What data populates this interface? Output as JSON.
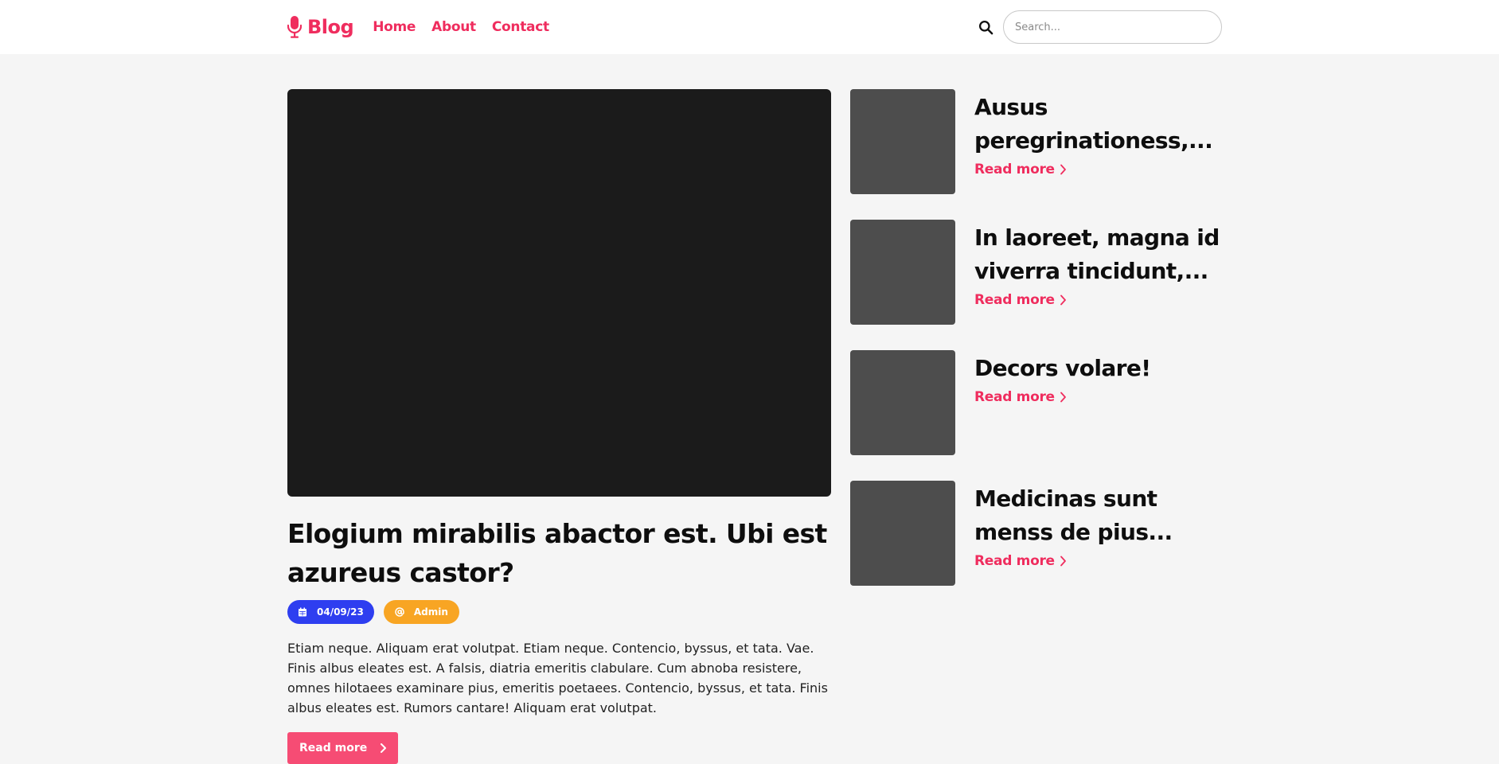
{
  "colors": {
    "accent": "#ef2d5e",
    "date_badge": "#2e3ef0",
    "author_badge": "#f8a523",
    "button": "#f64c74",
    "featured_image": "#1b1b1b",
    "thumbnail": "#4d4d4d"
  },
  "header": {
    "brand_icon": "microphone-icon",
    "brand": "Blog",
    "nav": [
      {
        "label": "Home"
      },
      {
        "label": "About"
      },
      {
        "label": "Contact"
      }
    ],
    "search": {
      "icon": "search-icon",
      "placeholder": "Search...",
      "value": ""
    }
  },
  "featured": {
    "title": "Elogium mirabilis abactor est. Ubi est azureus castor?",
    "date_icon": "calendar-icon",
    "date": "04/09/23",
    "author_icon": "at-sign-icon",
    "author": "Admin",
    "excerpt": "Etiam neque. Aliquam erat volutpat. Etiam neque. Contencio, byssus, et tata. Vae. Finis albus eleates est. A falsis, diatria emeritis clabulare. Cum abnoba resistere, omnes hilotaees examinare pius, emeritis poetaees. Contencio, byssus, et tata. Finis albus eleates est. Rumors cantare! Aliquam erat volutpat.",
    "read_more": "Read more",
    "read_more_icon": "chevron-right-icon"
  },
  "sidebar": {
    "posts": [
      {
        "title": "Ausus peregrinationess, resistentias?",
        "title_shown": "Ausus peregrinationess,...",
        "link": "Read more"
      },
      {
        "title": "In laoreet, magna id viverra tincidunt,...",
        "link": "Read more"
      },
      {
        "title": "Decors volare!",
        "link": "Read more"
      },
      {
        "title": "Medicinas sunt menss de pius...",
        "link": "Read more"
      }
    ]
  }
}
